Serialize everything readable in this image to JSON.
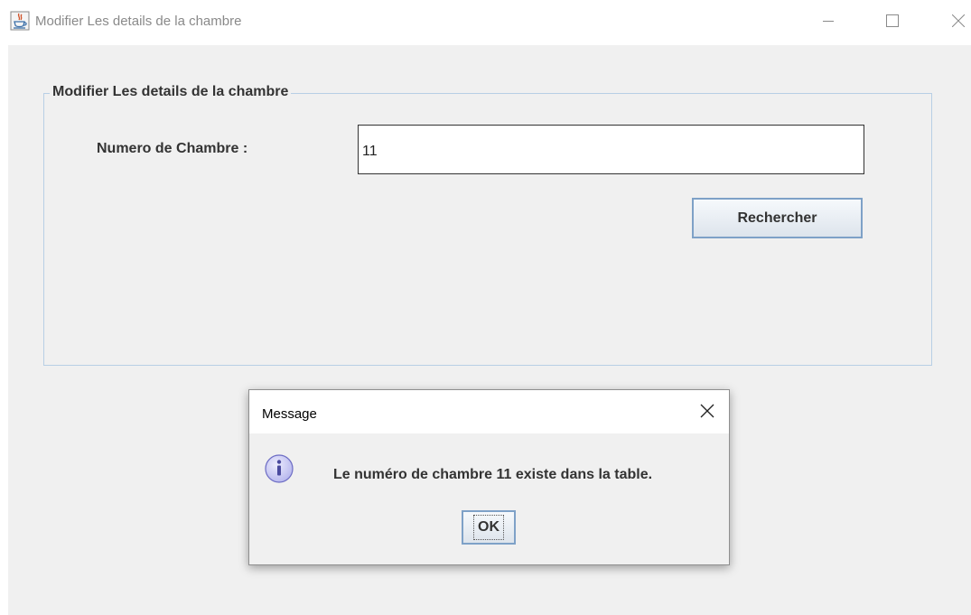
{
  "window": {
    "title": "Modifier Les details de la chambre",
    "icon": "java-cup-icon",
    "controls": [
      "minimize-icon",
      "maximize-icon",
      "close-icon"
    ]
  },
  "form": {
    "group_title": "Modifier Les details de la chambre",
    "room_number_label": "Numero de Chambre :",
    "room_number_value": "11",
    "search_button_label": "Rechercher"
  },
  "dialog": {
    "title": "Message",
    "icon": "info-icon",
    "message_prefix": "Le numéro de chambre ",
    "message_number": "11",
    "message_suffix": " existe dans la table.",
    "ok_label": "OK"
  },
  "colors": {
    "client_background": "#f0f0f0",
    "group_border": "#b8cfe5",
    "button_border": "#7ea1c7",
    "info_icon": "#c8c8f4"
  }
}
